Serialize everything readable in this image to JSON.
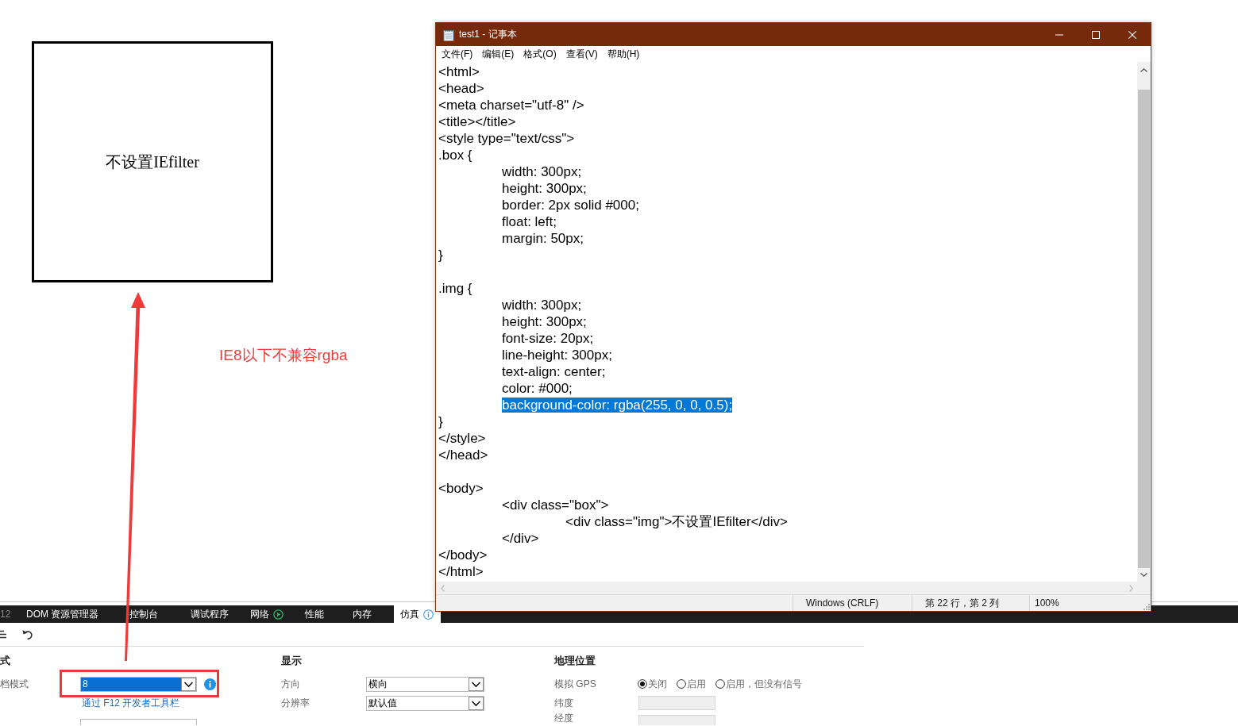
{
  "page": {
    "box_text": "不设置IEfilter",
    "annotation": "IE8以下不兼容rgba"
  },
  "notepad": {
    "title": "test1 - 记事本",
    "menu": [
      "文件(F)",
      "编辑(E)",
      "格式(O)",
      "查看(V)",
      "帮助(H)"
    ],
    "blocks": [
      {
        "lines": [
          {
            "text": "<html>",
            "selected": false
          },
          {
            "text": "<head>",
            "selected": false
          },
          {
            "text": "<meta charset=\"utf-8\" />",
            "selected": false
          },
          {
            "text": "<title></title>",
            "selected": false
          },
          {
            "text": "<style type=\"text/css\">",
            "selected": false
          },
          {
            "text": ".box {",
            "selected": false
          },
          {
            "text": "\twidth: 300px;",
            "selected": false
          },
          {
            "text": "\theight: 300px;",
            "selected": false
          },
          {
            "text": "\tborder: 2px solid #000;",
            "selected": false
          },
          {
            "text": "\tfloat: left;",
            "selected": false
          },
          {
            "text": "\tmargin: 50px;",
            "selected": false
          },
          {
            "text": "}",
            "selected": false
          }
        ]
      },
      {
        "lines": [
          {
            "text": ".img {",
            "selected": false
          },
          {
            "text": "\twidth: 300px;",
            "selected": false
          },
          {
            "text": "\theight: 300px;",
            "selected": false
          },
          {
            "text": "\tfont-size: 20px;",
            "selected": false
          },
          {
            "text": "\tline-height: 300px;",
            "selected": false
          },
          {
            "text": "\ttext-align: center;",
            "selected": false
          },
          {
            "text": "\tcolor: #000;",
            "selected": false
          },
          {
            "text": "\tbackground-color: rgba(255, 0, 0, 0.5);",
            "selected": true
          },
          {
            "text": "}",
            "selected": false
          },
          {
            "text": "</style>",
            "selected": false
          },
          {
            "text": "</head>",
            "selected": false
          }
        ]
      },
      {
        "lines": [
          {
            "text": "<body>",
            "selected": false
          },
          {
            "text": "\t<div class=\"box\">",
            "selected": false
          },
          {
            "text": "\t\t<div class=\"img\">不设置IEfilter</div>",
            "selected": false
          },
          {
            "text": "\t</div>",
            "selected": false
          },
          {
            "text": "</body>",
            "selected": false
          },
          {
            "text": "</html>",
            "selected": false
          }
        ]
      }
    ],
    "status_bar": {
      "line_ending": "Windows (CRLF)",
      "position": "第 22 行，第 2 列",
      "zoom": "100%"
    }
  },
  "devtools": {
    "tabs": [
      {
        "label": "12",
        "kind": "brand",
        "selected": false
      },
      {
        "label": "DOM 资源管理器",
        "kind": "plain",
        "selected": false
      },
      {
        "label": "控制台",
        "kind": "plain",
        "selected": false
      },
      {
        "label": "调试程序",
        "kind": "plain",
        "selected": false
      },
      {
        "label": "网络",
        "kind": "capture",
        "selected": false
      },
      {
        "label": "性能",
        "kind": "plain",
        "selected": false
      },
      {
        "label": "内存",
        "kind": "plain",
        "selected": false
      },
      {
        "label": "仿真",
        "kind": "info",
        "selected": true
      }
    ],
    "sections": [
      {
        "heading": "式",
        "rows": [
          {
            "kind": "dropdown",
            "label": "档模式",
            "value": "8",
            "focused": true,
            "info": true
          },
          {
            "kind": "link",
            "text": "通过 F12 开发者工具栏"
          },
          {
            "kind": "dropdown"
          }
        ]
      },
      {
        "heading": "显示",
        "rows": [
          {
            "kind": "dropdown",
            "label": "方向",
            "value": "横向",
            "focused": false,
            "info": false
          },
          {
            "kind": "dropdown",
            "label": "分辨率",
            "value": "默认值",
            "focused": false,
            "info": false
          }
        ]
      },
      {
        "heading": "地理位置",
        "rows": [
          {
            "kind": "radios",
            "label": "模拟 GPS",
            "options": [
              {
                "label": "关闭",
                "selected": true
              },
              {
                "label": "启用",
                "selected": false
              },
              {
                "label": "启用，但没有信号",
                "selected": false
              }
            ]
          },
          {
            "kind": "textbox",
            "label": "纬度",
            "disabled": true
          },
          {
            "kind": "textbox",
            "label": "经度",
            "disabled": true
          }
        ]
      }
    ]
  }
}
